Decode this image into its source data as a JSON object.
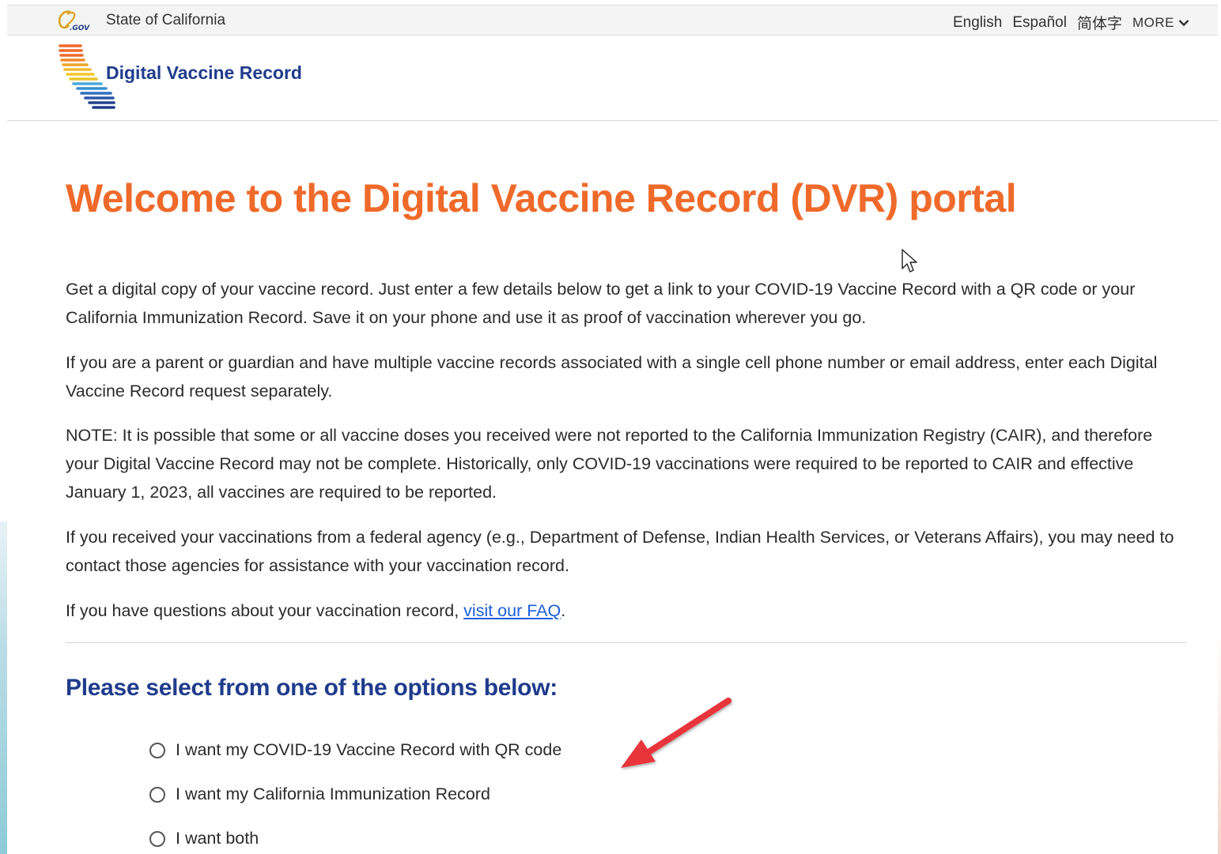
{
  "utility_bar": {
    "logo_text": "CA.GOV",
    "state_label": "State of California",
    "languages": [
      "English",
      "Español",
      "简体字"
    ],
    "more_label": "MORE"
  },
  "header": {
    "site_title": "Digital Vaccine Record"
  },
  "main": {
    "title": "Welcome to the Digital Vaccine Record (DVR) portal",
    "paragraphs": [
      "Get a digital copy of your vaccine record. Just enter a few details below to get a link to your COVID-19 Vaccine Record with a QR code or your California Immunization Record. Save it on your phone and use it as proof of vaccination wherever you go.",
      "If you are a parent or guardian and have multiple vaccine records associated with a single cell phone number or email address, enter each Digital Vaccine Record request separately.",
      "NOTE: It is possible that some or all vaccine doses you received were not reported to the California Immunization Registry (CAIR), and therefore your Digital Vaccine Record may not be complete. Historically, only COVID-19 vaccinations were required to be reported to CAIR and effective January 1, 2023, all vaccines are required to be reported.",
      "If you received your vaccinations from a federal agency (e.g., Department of Defense, Indian Health Services, or Veterans Affairs), you may need to contact those agencies for assistance with your vaccination record."
    ],
    "faq": {
      "prefix": "If you have questions about your vaccination record, ",
      "link_text": "visit our FAQ",
      "suffix": "."
    },
    "options_title": "Please select from one of the options below:",
    "options": [
      "I want my COVID-19 Vaccine Record with QR code",
      "I want my California Immunization Record",
      "I want both"
    ]
  },
  "colors": {
    "title_orange": "#ef6a2a",
    "brand_blue": "#1f3c8c",
    "link_blue": "#1a5ed8",
    "annotation_red": "#e8343a"
  },
  "icons": [
    "ca-gov-logo",
    "dvr-logo-icon",
    "chevron-down-icon",
    "radio-icon",
    "annotation-arrow-icon",
    "mouse-cursor-icon"
  ]
}
